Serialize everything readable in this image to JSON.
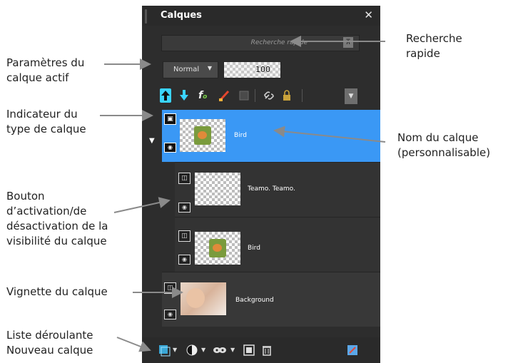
{
  "panel": {
    "title": "Calques",
    "close_glyph": "✕",
    "search": {
      "placeholder": "Recherche rapide",
      "value": ""
    },
    "blend_mode": "Normal",
    "opacity": "100",
    "toolbar_icons": [
      "move-layer-up-icon",
      "move-layer-down-icon",
      "fx-effects-icon",
      "paint-brush-icon",
      "mask-icon",
      "link-icon",
      "lock-icon"
    ],
    "layers": [
      {
        "name": "Bird",
        "selected": true,
        "group": false,
        "thumb": "bird"
      },
      {
        "name": "Teamo. Teamo.",
        "selected": false,
        "group": true,
        "thumb": "transparent"
      },
      {
        "name": "Bird",
        "selected": false,
        "group": true,
        "thumb": "bird"
      },
      {
        "name": "Background",
        "selected": false,
        "group": false,
        "thumb": "baby"
      }
    ],
    "bottom_icons": [
      "new-layer-icon",
      "mask-icon",
      "adjustment-icon",
      "group-icon",
      "trash-icon",
      "properties-icon"
    ]
  },
  "callouts": {
    "search": [
      "Recherche",
      "rapide"
    ],
    "params": [
      "Paramètres du",
      "calque actif"
    ],
    "type": [
      "Indicateur du",
      "type de calque"
    ],
    "name": [
      "Nom du calque",
      "(personnalisable)"
    ],
    "visibility": [
      "Bouton",
      "d’activation/de",
      "désactivation de la",
      "visibilité du calque"
    ],
    "thumb": [
      "Vignette du calque"
    ],
    "new": [
      "Liste déroulante",
      "Nouveau calque"
    ]
  },
  "colors": {
    "selected_row": "#3a98f5",
    "panel_bg": "#2d2d2d"
  }
}
